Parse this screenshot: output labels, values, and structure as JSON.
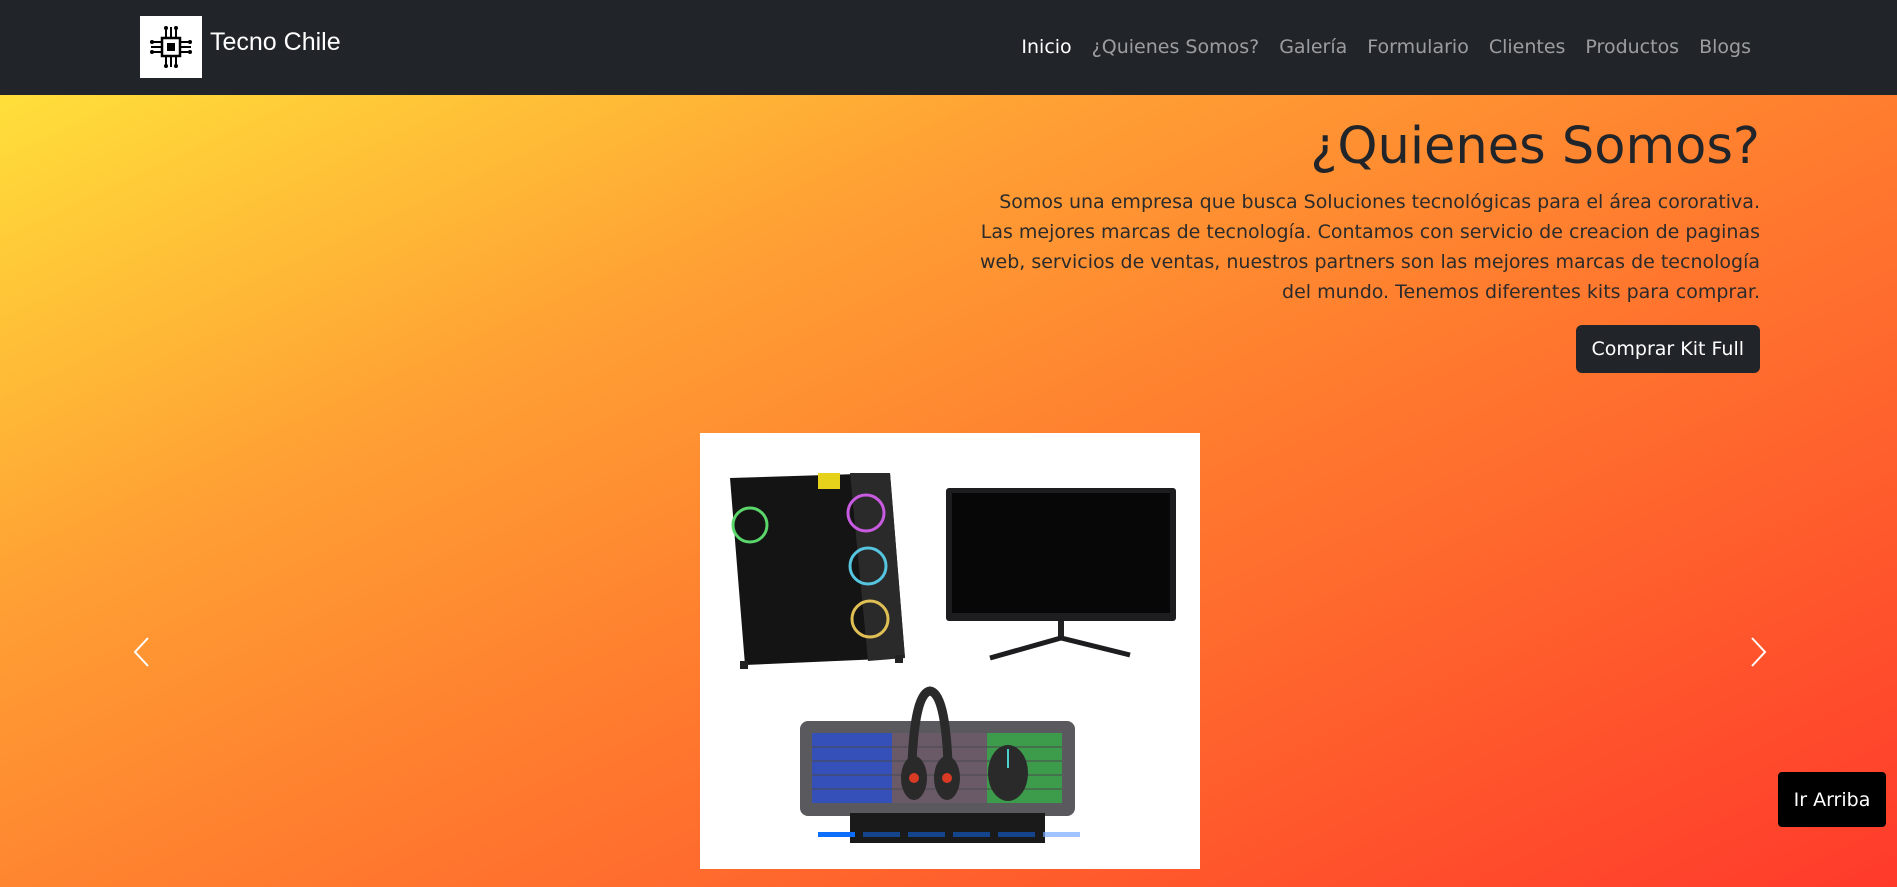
{
  "navbar": {
    "brand_name": "Tecno Chile",
    "logo_icon": "circuit-chip-icon",
    "links": [
      {
        "label": "Inicio",
        "active": true
      },
      {
        "label": "¿Quienes Somos?",
        "active": false
      },
      {
        "label": "Galería",
        "active": false
      },
      {
        "label": "Formulario",
        "active": false
      },
      {
        "label": "Clientes",
        "active": false
      },
      {
        "label": "Productos",
        "active": false
      },
      {
        "label": "Blogs",
        "active": false
      }
    ]
  },
  "hero": {
    "title": "¿Quienes Somos?",
    "description": "Somos una empresa que busca Soluciones tecnológicas para el área cororativa. Las mejores marcas de tecnología. Contamos con servicio de creacion de paginas web, servicios de ventas, nuestros partners son las mejores marcas de tecnología del mundo. Tenemos diferentes kits para comprar.",
    "cta_label": "Comprar Kit Full"
  },
  "carousel": {
    "prev_icon": "chevron-left-icon",
    "next_icon": "chevron-right-icon",
    "slide_count": 6,
    "active_index": 0
  },
  "scroll_top_label": "Ir Arriba",
  "colors": {
    "navbar_bg": "#212529",
    "gradient_start": "#ffdf3a",
    "gradient_end": "#ff3a2b",
    "indicator_active": "#0d6efd"
  }
}
